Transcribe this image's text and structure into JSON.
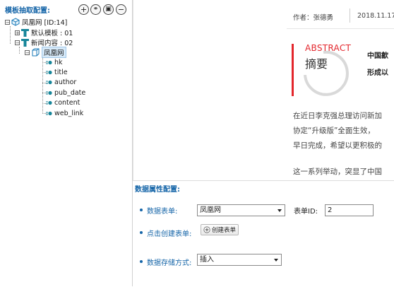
{
  "left_panel": {
    "title": "模板抽取配置:",
    "toolbar": {
      "add": "+",
      "link": "⚭",
      "save": "▣",
      "remove": "−"
    },
    "tree": {
      "root": "凤凰网 [ID:14]",
      "default_template": "默认模板 : 01",
      "news_content": "新闻内容 : 02",
      "form": "凤凰网",
      "fields": [
        "hk",
        "title",
        "author",
        "pub_date",
        "content",
        "web_link"
      ]
    }
  },
  "preview": {
    "author": "作者：张德勇",
    "date": "2018.11.17",
    "abstract_en": "ABSTRACT",
    "abstract_cn": "摘要",
    "summary_line1": "中国歙",
    "summary_line2": "形成以",
    "para1_line1": "在近日李克强总理访问新加",
    "para1_line2": "协定“升级版”全面生效，",
    "para1_line3": "早日完成，希望以更积极的",
    "para2_line1": "这一系列举动，突显了中国",
    "accent_color": "#e3262c"
  },
  "config": {
    "title": "数据属性配置:",
    "form_label": "数据表单:",
    "form_value": "凤凰网",
    "form_id_label": "表单ID:",
    "form_id_value": "2",
    "create_label": "点击创建表单:",
    "create_button": "创建表单",
    "storage_label": "数据存储方式:",
    "storage_value": "插入",
    "label_color": "#1565a8"
  }
}
